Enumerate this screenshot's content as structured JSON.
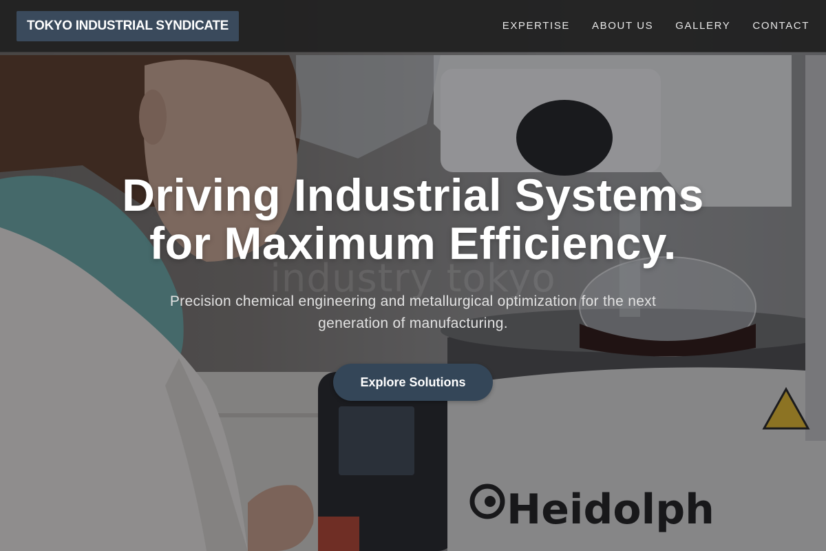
{
  "brand": {
    "name": "TOKYO INDUSTRIAL SYNDICATE"
  },
  "nav": {
    "items": [
      {
        "label": "EXPERTISE"
      },
      {
        "label": "ABOUT US"
      },
      {
        "label": "GALLERY"
      },
      {
        "label": "CONTACT"
      }
    ]
  },
  "hero": {
    "title_line1": "Driving Industrial Systems",
    "title_line2": "for Maximum Efficiency.",
    "subtitle": "Precision chemical engineering and metallurgical optimization for the next generation of manufacturing.",
    "cta_label": "Explore Solutions",
    "watermark": "industry tokyo",
    "device_brand": "Heidolph"
  },
  "colors": {
    "nav_bg": "#202020",
    "brand_bg": "#3a4a5c",
    "cta_bg": "#344658",
    "text_light": "#ffffff"
  }
}
